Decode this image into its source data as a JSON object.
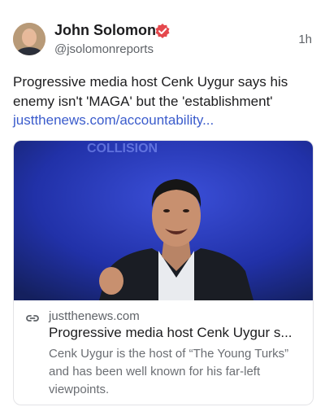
{
  "post": {
    "author_name": "John Solomon",
    "handle": "@jsolomonreports",
    "timestamp": "1h",
    "text": "Progressive media host Cenk Uygur says his enemy isn't 'MAGA' but the 'establishment'",
    "link_text": "justthenews.com/accountability...",
    "verified_icon": "verified-badge-icon",
    "accent_color": "#e5484d",
    "link_color": "#3b5ccc"
  },
  "card": {
    "domain": "justthenews.com",
    "title": "Progressive media host Cenk Uygur s...",
    "description": "Cenk Uygur is the host of “The Young Turks” and has been well known for his far-left viewpoints.",
    "image_banner_text": "COLLISION",
    "link_icon": "link-icon"
  }
}
